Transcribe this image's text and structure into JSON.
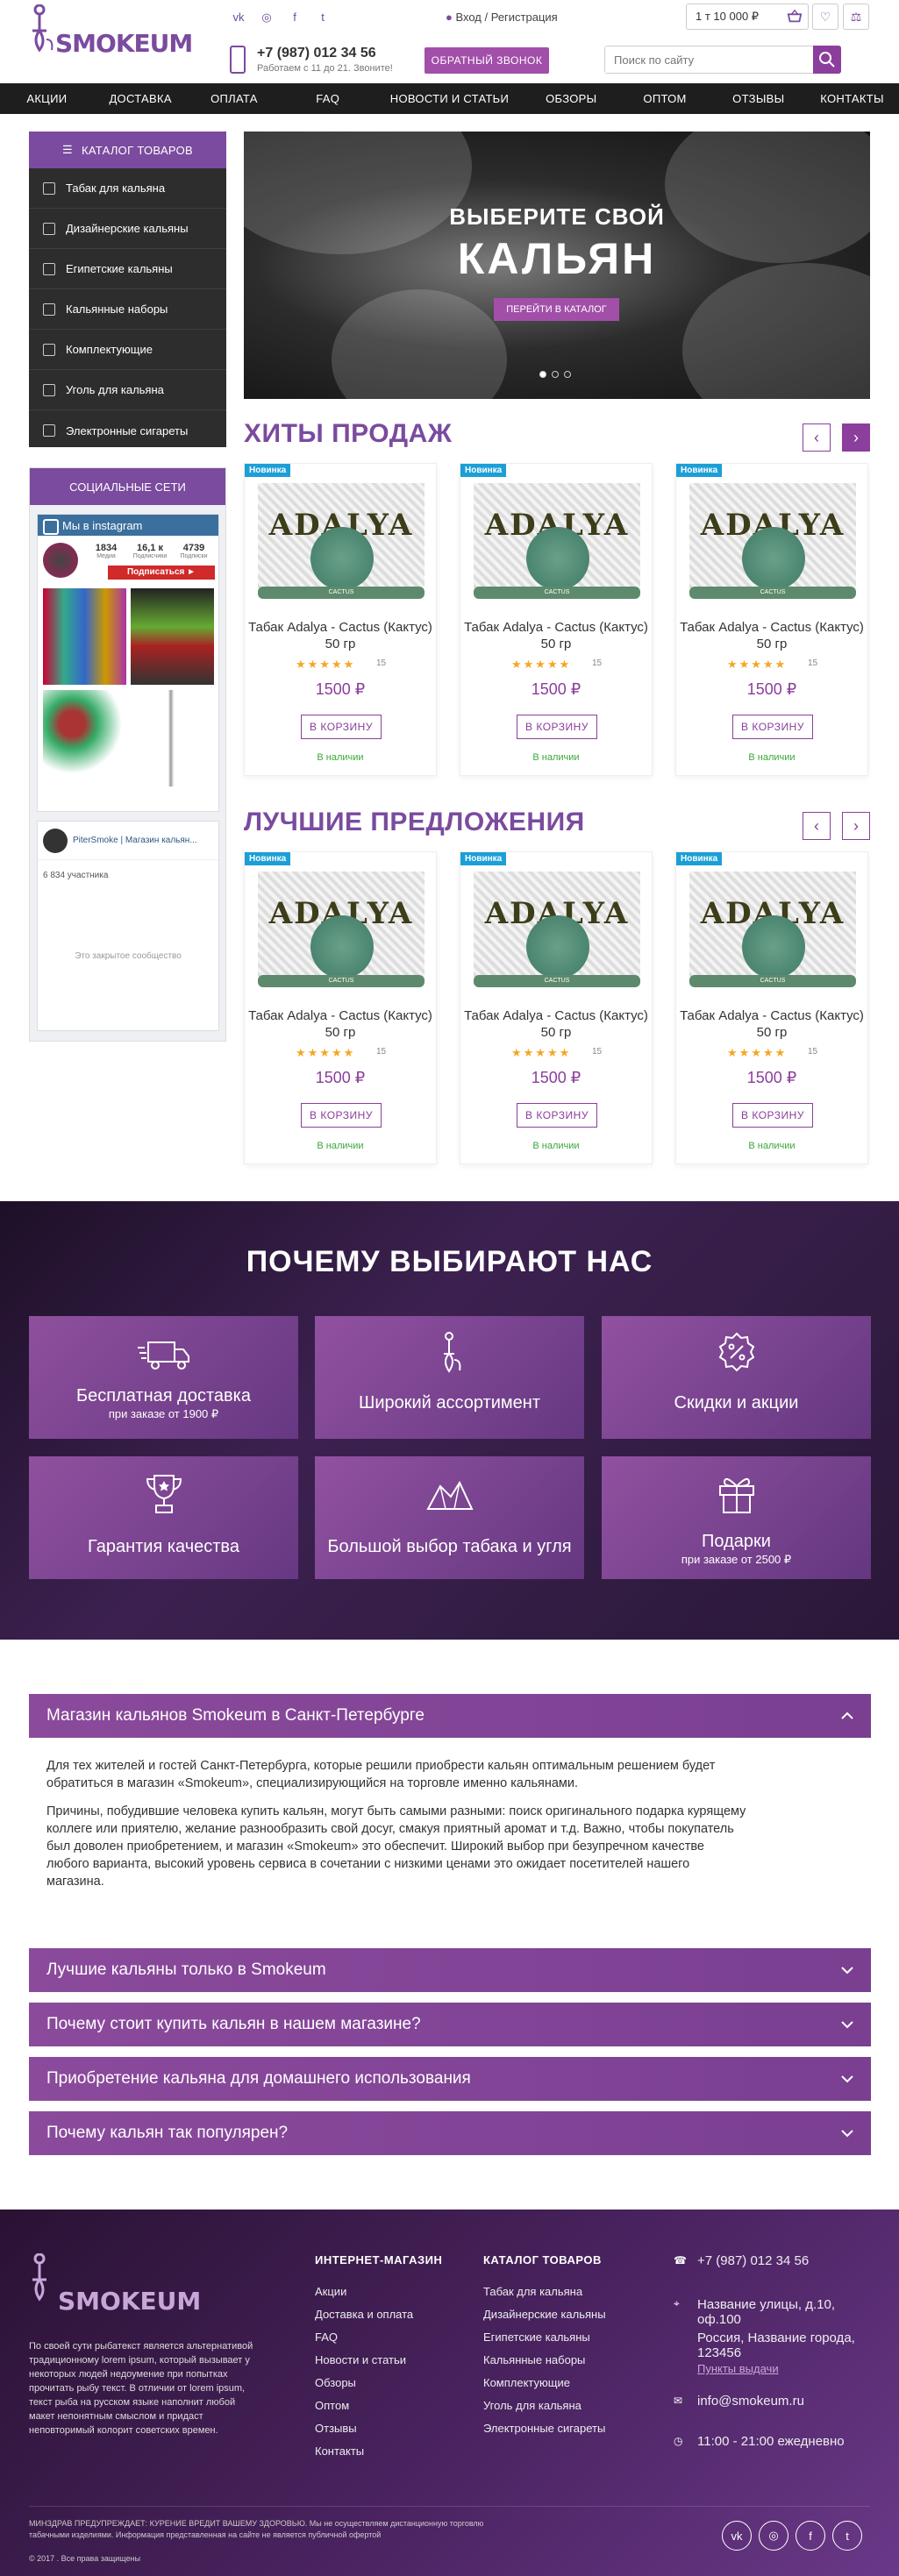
{
  "header": {
    "logo_text": "SMOKEUM",
    "social": [
      "vk-icon",
      "instagram-icon",
      "facebook-icon",
      "twitter-icon"
    ],
    "login": "Вход / Регистрация",
    "cart": "1 т 10 000 ₽",
    "phone": "+7 (987) 012 34 56",
    "hours": "Работаем с 11 до 21. Звоните!",
    "callback": "ОБРАТНЫЙ ЗВОНОК",
    "search_placeholder": "Поиск по сайту"
  },
  "nav": [
    "АКЦИИ",
    "ДОСТАВКА",
    "ОПЛАТА",
    "FAQ",
    "НОВОСТИ И СТАТЬИ",
    "ОБЗОРЫ",
    "ОПТОМ",
    "ОТЗЫВЫ",
    "КОНТАКТЫ"
  ],
  "catalog": {
    "title": "КАТАЛОГ ТОВАРОВ",
    "items": [
      "Табак для кальяна",
      "Дизайнерские кальяны",
      "Египетские кальяны",
      "Кальянные наборы",
      "Комплектующие",
      "Уголь для кальяна",
      "Электронные сигареты"
    ]
  },
  "social_box": {
    "title": "СОЦИАЛЬНЫЕ СЕТИ",
    "insta_title": "Мы в instagram",
    "stats": [
      {
        "n": "1834",
        "l": "Медиа"
      },
      {
        "n": "16,1 к",
        "l": "Подписчики"
      },
      {
        "n": "4739",
        "l": "Подписки"
      }
    ],
    "follow": "Подписаться ►",
    "vk_name": "PiterSmoke | Магазин кальян...",
    "vk_members": "6 834 участника",
    "vk_closed": "Это закрытое сообщество"
  },
  "banner": {
    "line1": "ВЫБЕРИТЕ СВОЙ",
    "line2": "КАЛЬЯН",
    "button": "ПЕРЕЙТИ В КАТАЛОГ"
  },
  "hits": {
    "title": "ХИТЫ ПРОДАЖ",
    "products": [
      {
        "badge": "Новинка",
        "brand": "ADALYA",
        "band": "CACTUS",
        "name": "Табак Adalya - Cactus (Кактус) 50 гр",
        "rating": "15",
        "price": "1500 ₽",
        "cart": "В КОРЗИНУ",
        "avail": "В наличии"
      },
      {
        "badge": "Новинка",
        "brand": "ADALYA",
        "band": "CACTUS",
        "name": "Табак Adalya - Cactus (Кактус) 50 гр",
        "rating": "15",
        "price": "1500 ₽",
        "cart": "В КОРЗИНУ",
        "avail": "В наличии"
      },
      {
        "badge": "Новинка",
        "brand": "ADALYA",
        "band": "CACTUS",
        "name": "Табак Adalya - Cactus (Кактус) 50 гр",
        "rating": "15",
        "price": "1500 ₽",
        "cart": "В КОРЗИНУ",
        "avail": "В наличии"
      }
    ]
  },
  "best": {
    "title": "ЛУЧШИЕ ПРЕДЛОЖЕНИЯ",
    "products": [
      {
        "badge": "Новинка",
        "brand": "ADALYA",
        "band": "CACTUS",
        "name": "Табак Adalya - Cactus (Кактус) 50 гр",
        "rating": "15",
        "price": "1500 ₽",
        "cart": "В КОРЗИНУ",
        "avail": "В наличии"
      },
      {
        "badge": "Новинка",
        "brand": "ADALYA",
        "band": "CACTUS",
        "name": "Табак Adalya - Cactus (Кактус) 50 гр",
        "rating": "15",
        "price": "1500 ₽",
        "cart": "В КОРЗИНУ",
        "avail": "В наличии"
      },
      {
        "badge": "Новинка",
        "brand": "ADALYA",
        "band": "CACTUS",
        "name": "Табак Adalya - Cactus (Кактус) 50 гр",
        "rating": "15",
        "price": "1500 ₽",
        "cart": "В КОРЗИНУ",
        "avail": "В наличии"
      }
    ]
  },
  "why": {
    "title": "ПОЧЕМУ ВЫБИРАЮТ НАС",
    "tiles": [
      {
        "icon": "truck-icon",
        "title": "Бесплатная доставка",
        "sub": "при заказе от 1900 ₽"
      },
      {
        "icon": "hookah-icon",
        "title": "Широкий ассортимент",
        "sub": ""
      },
      {
        "icon": "discount-icon",
        "title": "Скидки и акции",
        "sub": ""
      },
      {
        "icon": "trophy-icon",
        "title": "Гарантия качества",
        "sub": ""
      },
      {
        "icon": "coal-icon",
        "title": "Большой выбор табака и угля",
        "sub": ""
      },
      {
        "icon": "gift-icon",
        "title": "Подарки",
        "sub": "при заказе от 2500 ₽"
      }
    ]
  },
  "accordion": {
    "open_title": "Магазин кальянов Smokeum в Санкт-Петербурге",
    "p1": "Для тех жителей и гостей Санкт-Петербурга, которые решили приобрести кальян оптимальным решением будет обратиться в магазин «Smokeum», специализирующийся на торговле именно кальянами.",
    "p2": "Причины, побудившие человека купить кальян, могут быть самыми разными: поиск оригинального подарка курящему коллеге или приятелю, желание разнообразить свой досуг, смакуя приятный аромат и т.д. Важно, чтобы покупатель был доволен приобретением, и магазин «Smokeum» это обеспечит. Широкий выбор при безупречном качестве любого варианта, высокий уровень сервиса в сочетании с низкими ценами это ожидает посетителей нашего магазина.",
    "closed": [
      "Лучшие кальяны только в Smokeum",
      "Почему стоит купить кальян в нашем магазине?",
      "Приобретение кальяна для домашнего использования",
      "Почему кальян так популярен?"
    ]
  },
  "footer": {
    "logo_text": "SMOKEUM",
    "about": "По своей сути рыбатекст является альтернативой традиционному lorem ipsum, который вызывает у некоторых людей недоумение при попытках прочитать рыбу текст. В отличии от lorem ipsum, текст рыба на русском языке наполнит любой макет непонятным смыслом и придаст неповторимый колорит советских времен.",
    "shop_title": "ИНТЕРНЕТ-МАГАЗИН",
    "shop_links": [
      "Акции",
      "Доставка и оплата",
      "FAQ",
      "Новости и статьи",
      "Обзоры",
      "Оптом",
      "Отзывы",
      "Контакты"
    ],
    "cat_title": "КАТАЛОГ ТОВАРОВ",
    "cat_links": [
      "Табак для кальяна",
      "Дизайнерские кальяны",
      "Египетские кальяны",
      "Кальянные наборы",
      "Комплектующие",
      "Уголь для кальяна",
      "Электронные сигареты"
    ],
    "phone": "+7 (987) 012 34 56",
    "address": "Название улицы, д.10, оф.100",
    "address2": "Россия, Название города, 123456",
    "pickup": "Пункты выдачи",
    "email": "info@smokeum.ru",
    "hours": "11:00 - 21:00 ежедневно",
    "warning": "МИНЗДРАВ ПРЕДУПРЕЖДАЕТ: КУРЕНИЕ ВРЕДИТ ВАШЕМУ ЗДОРОВЬЮ. Мы не осуществляем дистанционную торговлю табачными изделиями. Информация представленная на сайте не является публичной офертой",
    "copyright": "© 2017 . Все права защищены",
    "social": [
      "vk-icon",
      "instagram-icon",
      "facebook-icon",
      "twitter-icon"
    ]
  }
}
